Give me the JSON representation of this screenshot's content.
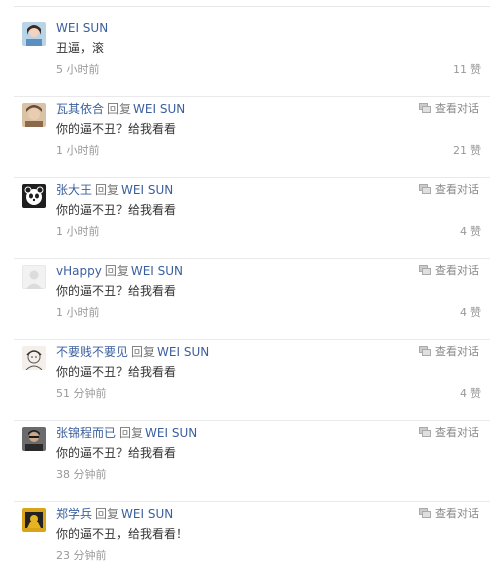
{
  "comments": [
    {
      "user": "WEI SUN",
      "reply_word": "",
      "reply_target": "",
      "text": "丑逼，滚",
      "time": "5 小时前",
      "view_label": "",
      "likes": "11",
      "likes_word": "赞",
      "avatar_color": "#7aa7c7"
    },
    {
      "user": "瓦其依合",
      "reply_word": "回复",
      "reply_target": "WEI SUN",
      "text": "你的逼不丑？给我看看",
      "time": "1 小时前",
      "view_label": "查看对话",
      "likes": "21",
      "likes_word": "赞",
      "avatar_color": "#c9a27a"
    },
    {
      "user": "张大王",
      "reply_word": "回复",
      "reply_target": "WEI SUN",
      "text": "你的逼不丑？给我看看",
      "time": "1 小时前",
      "view_label": "查看对话",
      "likes": "4",
      "likes_word": "赞",
      "avatar_color": "#2c2c2c"
    },
    {
      "user": "vHappy",
      "reply_word": "回复",
      "reply_target": "WEI SUN",
      "text": "你的逼不丑？给我看看",
      "time": "1 小时前",
      "view_label": "查看对话",
      "likes": "4",
      "likes_word": "赞",
      "avatar_color": "#e8e8e8"
    },
    {
      "user": "不要贱不要见",
      "reply_word": "回复",
      "reply_target": "WEI SUN",
      "text": "你的逼不丑？给我看看",
      "time": "51 分钟前",
      "view_label": "查看对话",
      "likes": "4",
      "likes_word": "赞",
      "avatar_color": "#d8d0c8"
    },
    {
      "user": "张锦程而已",
      "reply_word": "回复",
      "reply_target": "WEI SUN",
      "text": "你的逼不丑？给我看看",
      "time": "38 分钟前",
      "view_label": "查看对话",
      "likes": "",
      "likes_word": "",
      "avatar_color": "#4a4a4a"
    },
    {
      "user": "郑学兵",
      "reply_word": "回复",
      "reply_target": "WEI SUN",
      "text": "你的逼不丑，给我看看！",
      "time": "23 分钟前",
      "view_label": "查看对话",
      "likes": "",
      "likes_word": "",
      "avatar_color": "#d4a017"
    }
  ],
  "colors": {
    "link": "#3a5f9e",
    "muted": "#999999",
    "divider": "#e9e9e9"
  }
}
